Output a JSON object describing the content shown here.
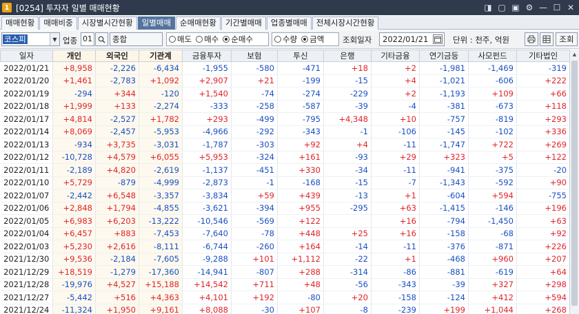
{
  "titlebar": {
    "num": "1",
    "title": "[0254] 투자자 일별 매매현황",
    "icons": [
      "◨",
      "▢",
      "▣",
      "⚙",
      "—",
      "☐",
      "✕"
    ]
  },
  "tabs": [
    "매매현황",
    "매매비중",
    "시장별시간현황",
    "일별매매",
    "순매매현황",
    "기간별매매",
    "업종별매매",
    "전체시장시간현황"
  ],
  "toolbar": {
    "market": "코스피",
    "market_arrow": "▼",
    "sector_label": "업종",
    "sector_code": "01",
    "sector_name": "종합",
    "trade_options": [
      "매도",
      "매수",
      "순매수"
    ],
    "qty_options": [
      "수량",
      "금액"
    ],
    "date_label": "조회일자",
    "date": "2022/01/21",
    "unit": "단위 : 천주, 억원",
    "query": "조회"
  },
  "columns": [
    "일자",
    "개인",
    "외국인",
    "기관계",
    "금융투자",
    "보험",
    "투신",
    "은행",
    "기타금융",
    "연기금등",
    "사모펀드",
    "기타법인"
  ],
  "rows": [
    [
      "2022/01/21",
      "+8,958",
      "-2,226",
      "-6,434",
      "-1,955",
      "-580",
      "-471",
      "+18",
      "+2",
      "-1,981",
      "-1,469",
      "-319"
    ],
    [
      "2022/01/20",
      "+1,461",
      "-2,783",
      "+1,092",
      "+2,907",
      "+21",
      "-199",
      "-15",
      "+4",
      "-1,021",
      "-606",
      "+222"
    ],
    [
      "2022/01/19",
      "-294",
      "+344",
      "-120",
      "+1,540",
      "-74",
      "-274",
      "-229",
      "+2",
      "-1,193",
      "+109",
      "+66"
    ],
    [
      "2022/01/18",
      "+1,999",
      "+133",
      "-2,274",
      "-333",
      "-258",
      "-587",
      "-39",
      "-4",
      "-381",
      "-673",
      "+118"
    ],
    [
      "2022/01/17",
      "+4,814",
      "-2,527",
      "+1,782",
      "+293",
      "-499",
      "-795",
      "+4,348",
      "+10",
      "-757",
      "-819",
      "+293"
    ],
    [
      "2022/01/14",
      "+8,069",
      "-2,457",
      "-5,953",
      "-4,966",
      "-292",
      "-343",
      "-1",
      "-106",
      "-145",
      "-102",
      "+336"
    ],
    [
      "2022/01/13",
      "-934",
      "+3,735",
      "-3,031",
      "-1,787",
      "-303",
      "+92",
      "+4",
      "-11",
      "-1,747",
      "+722",
      "+269"
    ],
    [
      "2022/01/12",
      "-10,728",
      "+4,579",
      "+6,055",
      "+5,953",
      "-324",
      "+161",
      "-93",
      "+29",
      "+323",
      "+5",
      "+122"
    ],
    [
      "2022/01/11",
      "-2,189",
      "+4,820",
      "-2,619",
      "-1,137",
      "-451",
      "+330",
      "-34",
      "-11",
      "-941",
      "-375",
      "-20"
    ],
    [
      "2022/01/10",
      "+5,729",
      "-879",
      "-4,999",
      "-2,873",
      "-1",
      "-168",
      "-15",
      "-7",
      "-1,343",
      "-592",
      "+90"
    ],
    [
      "2022/01/07",
      "-2,442",
      "+6,548",
      "-3,357",
      "-3,834",
      "+59",
      "+439",
      "-13",
      "+1",
      "-604",
      "+594",
      "-755"
    ],
    [
      "2022/01/06",
      "+2,848",
      "+1,794",
      "-4,855",
      "-3,621",
      "-394",
      "+955",
      "-295",
      "+63",
      "-1,415",
      "-146",
      "+196"
    ],
    [
      "2022/01/05",
      "+6,983",
      "+6,203",
      "-13,222",
      "-10,546",
      "-569",
      "+122",
      "",
      "+16",
      "-794",
      "-1,450",
      "+63"
    ],
    [
      "2022/01/04",
      "+6,457",
      "+883",
      "-7,453",
      "-7,640",
      "-78",
      "+448",
      "+25",
      "+16",
      "-158",
      "-68",
      "+92"
    ],
    [
      "2022/01/03",
      "+5,230",
      "+2,616",
      "-8,111",
      "-6,744",
      "-260",
      "+164",
      "-14",
      "-11",
      "-376",
      "-871",
      "+226"
    ],
    [
      "2021/12/30",
      "+9,536",
      "-2,184",
      "-7,605",
      "-9,288",
      "+101",
      "+1,112",
      "-22",
      "+1",
      "-468",
      "+960",
      "+207"
    ],
    [
      "2021/12/29",
      "+18,519",
      "-1,279",
      "-17,360",
      "-14,941",
      "-807",
      "+288",
      "-314",
      "-86",
      "-881",
      "-619",
      "+64"
    ],
    [
      "2021/12/28",
      "-19,976",
      "+4,527",
      "+15,188",
      "+14,542",
      "+711",
      "+48",
      "-56",
      "-343",
      "-39",
      "+327",
      "+298"
    ],
    [
      "2021/12/27",
      "-5,442",
      "+516",
      "+4,363",
      "+4,101",
      "+192",
      "-80",
      "+20",
      "-158",
      "-124",
      "+412",
      "+594"
    ],
    [
      "2021/12/24",
      "-11,324",
      "+1,950",
      "+9,161",
      "+8,088",
      "-30",
      "+107",
      "-8",
      "-239",
      "+199",
      "+1,044",
      "+268"
    ]
  ],
  "colors": {
    "titlebar": "#2f3a4c",
    "active_tab": "#54739e",
    "positive": "#e0232a",
    "negative": "#1a4fc4",
    "highlight_col": "#fdf9ee"
  }
}
